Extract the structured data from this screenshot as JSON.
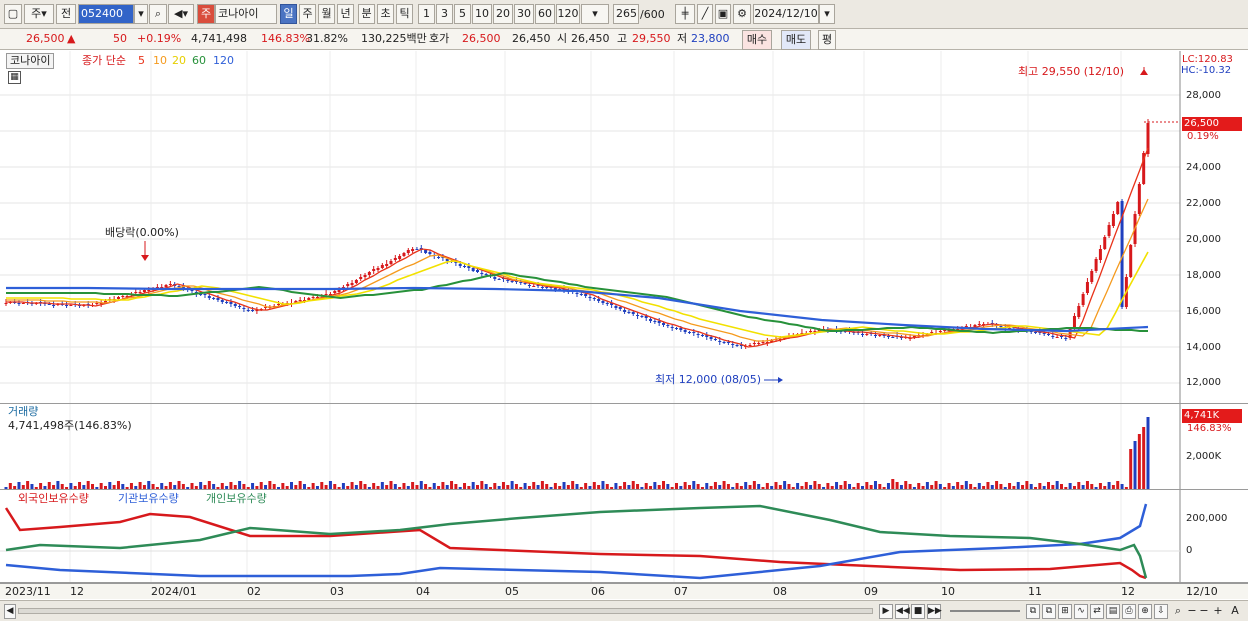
{
  "toolbar": {
    "market": "주",
    "prev": "전",
    "stock_code": "052400",
    "stock_name": "코나아이",
    "periods": [
      "일",
      "주",
      "월",
      "년",
      "분",
      "초",
      "틱"
    ],
    "minutes": [
      "1",
      "3",
      "5",
      "10",
      "20",
      "30",
      "60",
      "120"
    ],
    "count": "265",
    "count_max": "/600",
    "date": "2024/12/10"
  },
  "quote": {
    "price": "26,500",
    "change": "50",
    "change_pct": "+0.19%",
    "volume": "4,741,498",
    "vol_ratio": "146.83%",
    "turnover": "31.82%",
    "amount": "130,225백만",
    "ask_label": "호가",
    "ask": "26,500",
    "bid": "26,450",
    "open_label": "시",
    "open": "26,450",
    "high_label": "고",
    "high": "29,550",
    "low_label": "저",
    "low": "23,800",
    "buy": "매수",
    "sell": "매도",
    "eval": "평"
  },
  "price_panel": {
    "name": "코나아이",
    "ma_title": "종가 단순",
    "ma_periods": [
      "5",
      "10",
      "20",
      "60",
      "120"
    ],
    "lc": "LC:120.83",
    "hc": "HC:-10.32",
    "high_note": "최고 29,550 (12/10)",
    "low_note": "최저 12,000 (08/05)",
    "dividend_note": "배당락(0.00%)",
    "current": "26,500",
    "current_pct": "0.19%",
    "yticks": [
      "28,000",
      "26,000",
      "24,000",
      "22,000",
      "20,000",
      "18,000",
      "16,000",
      "14,000",
      "12,000"
    ]
  },
  "volume_panel": {
    "title": "거래량",
    "value": "4,741,498주(146.83%)",
    "current": "4,741K",
    "current_pct": "146.83%",
    "ytick": "2,000K"
  },
  "holdings_panel": {
    "legend": [
      "외국인보유수량",
      "기관보유수량",
      "개인보유수량"
    ],
    "yticks": [
      "200,000",
      "0"
    ]
  },
  "xaxis": [
    "2023/11",
    "12",
    "2024/01",
    "02",
    "03",
    "04",
    "05",
    "06",
    "07",
    "08",
    "09",
    "10",
    "11",
    "12",
    "12/10"
  ],
  "colors": {
    "up": "#d7191c",
    "down": "#1f3fbf",
    "ma5": "#e8331a",
    "ma10": "#f59a1d",
    "ma20": "#f2e100",
    "ma60": "#27913a",
    "ma120": "#2e5fd8",
    "foreign": "#d7191c",
    "inst": "#2e5fd8",
    "indiv": "#2e8b57"
  },
  "chart_data": {
    "type": "line",
    "x": [
      "2023/11",
      "12",
      "2024/01",
      "02",
      "03",
      "04",
      "05",
      "06",
      "07",
      "08",
      "09",
      "10",
      "11",
      "12",
      "12/10"
    ],
    "series": [
      {
        "name": "종가",
        "values": [
          16500,
          16300,
          17500,
          16000,
          17000,
          19500,
          17800,
          17000,
          15300,
          14000,
          15000,
          14500,
          15300,
          14500,
          26500
        ]
      },
      {
        "name": "120",
        "values": [
          17300,
          17300,
          17200,
          17200,
          17200,
          17300,
          17200,
          17100,
          16700,
          16000,
          15500,
          15200,
          15000,
          14900,
          15100
        ]
      }
    ],
    "ylim": [
      11000,
      30000
    ],
    "high": 29550,
    "low": 12000
  }
}
